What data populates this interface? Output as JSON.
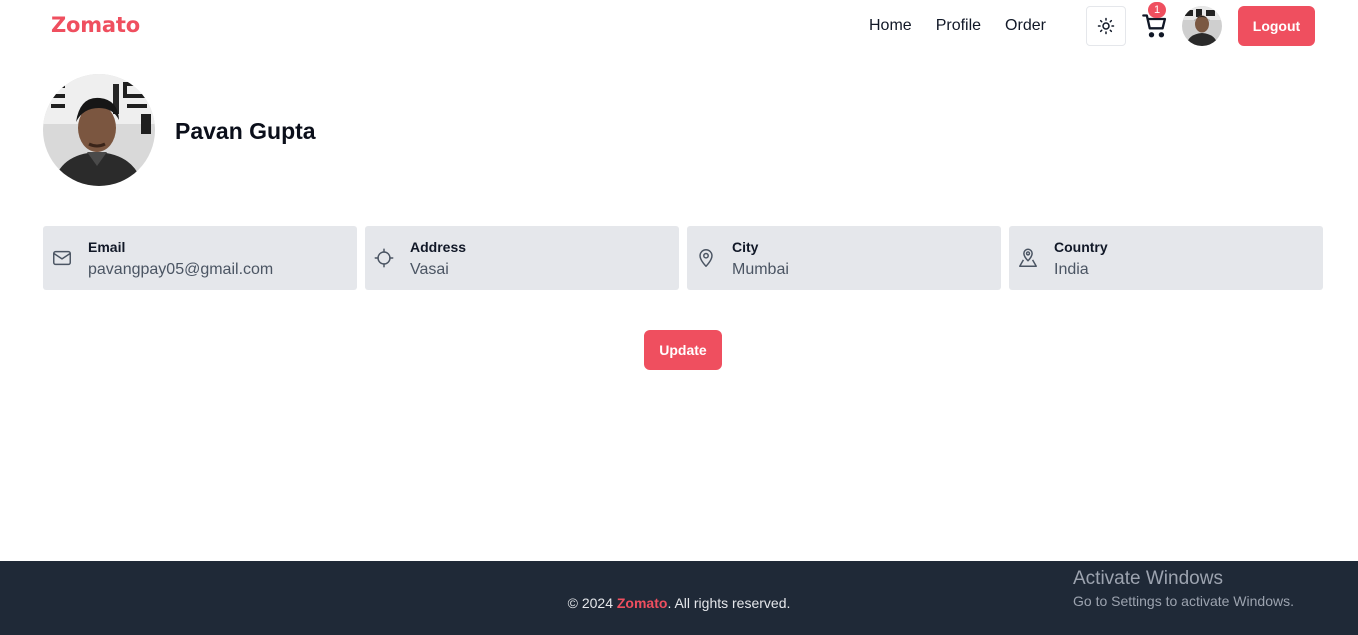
{
  "header": {
    "brand": "Zomato",
    "nav": [
      "Home",
      "Profile",
      "Order"
    ],
    "theme_icon": "sun-icon",
    "cart_icon": "shopping-cart-icon",
    "cart_count": "1",
    "logout_label": "Logout"
  },
  "profile": {
    "name": "Pavan Gupta",
    "fields": [
      {
        "icon": "mail-icon",
        "label": "Email",
        "value": "pavangpay05@gmail.com"
      },
      {
        "icon": "crosshair-icon",
        "label": "Address",
        "value": "Vasai"
      },
      {
        "icon": "map-pin-icon",
        "label": "City",
        "value": "Mumbai"
      },
      {
        "icon": "map-marker-icon",
        "label": "Country",
        "value": "India"
      }
    ],
    "update_label": "Update"
  },
  "footer": {
    "prefix": "© 2024 ",
    "brand": "Zomato",
    "suffix": ". All rights reserved."
  },
  "watermark": {
    "line1": "Activate Windows",
    "line2": "Go to Settings to activate Windows."
  },
  "colors": {
    "accent": "#ef4f5f",
    "card_bg": "#e5e7eb",
    "footer_bg": "#1f2937"
  }
}
